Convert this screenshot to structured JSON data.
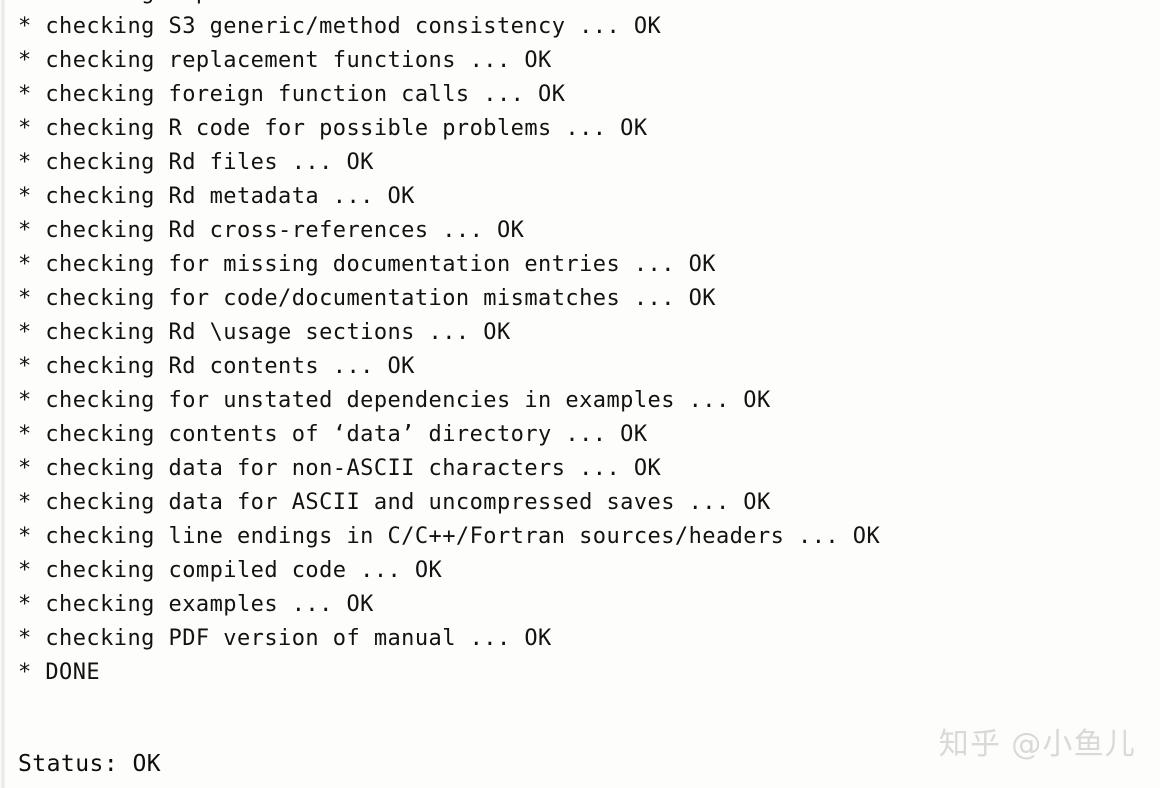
{
  "console": {
    "log_lines": [
      "* checking dependencies in R code ... OK",
      "* checking S3 generic/method consistency ... OK",
      "* checking replacement functions ... OK",
      "* checking foreign function calls ... OK",
      "* checking R code for possible problems ... OK",
      "* checking Rd files ... OK",
      "* checking Rd metadata ... OK",
      "* checking Rd cross-references ... OK",
      "* checking for missing documentation entries ... OK",
      "* checking for code/documentation mismatches ... OK",
      "* checking Rd \\usage sections ... OK",
      "* checking Rd contents ... OK",
      "* checking for unstated dependencies in examples ... OK",
      "* checking contents of ‘data’ directory ... OK",
      "* checking data for non-ASCII characters ... OK",
      "* checking data for ASCII and uncompressed saves ... OK",
      "* checking line endings in C/C++/Fortran sources/headers ... OK",
      "* checking compiled code ... OK",
      "* checking examples ... OK",
      "* checking PDF version of manual ... OK",
      "* DONE",
      "",
      ""
    ],
    "status_line": "Status: OK"
  },
  "watermark": {
    "brand": "知乎",
    "handle": "@小鱼儿"
  },
  "colors": {
    "background": "#fdfdfc",
    "text": "#121212",
    "gutter": "#e6e6e6",
    "watermark": "#d9d9d9"
  }
}
